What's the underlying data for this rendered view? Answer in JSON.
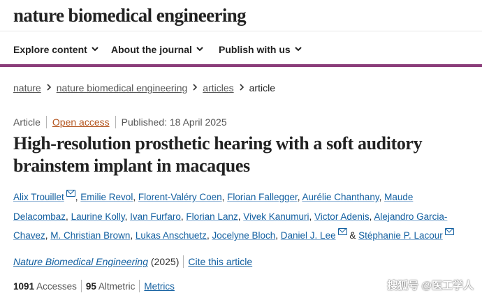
{
  "site": {
    "brand": "nature biomedical engineering"
  },
  "nav": {
    "items": [
      {
        "label": "Explore content"
      },
      {
        "label": "About the journal"
      },
      {
        "label": "Publish with us"
      }
    ]
  },
  "breadcrumb": {
    "items": [
      "nature",
      "nature biomedical engineering",
      "articles"
    ],
    "current": "article"
  },
  "article": {
    "type": "Article",
    "access": "Open access",
    "published": "Published: 18 April 2025",
    "title": "High-resolution prosthetic hearing with a soft auditory brainstem implant in macaques",
    "authors": [
      "Alix Trouillet",
      "Emilie Revol",
      "Florent-Valéry Coen",
      "Florian Fallegger",
      "Aurélie Chanthany",
      "Maude Delacombaz",
      "Laurine Kolly",
      "Ivan Furfaro",
      "Florian Lanz",
      "Vivek Kanumuri",
      "Victor Adenis",
      "Alejandro Garcia-Chavez",
      "M. Christian Brown",
      "Lukas Anschuetz",
      "Jocelyne Bloch",
      "Daniel J. Lee",
      "Stéphanie P. Lacour"
    ],
    "authors_ampersand": "&",
    "journal": "Nature Biomedical Engineering",
    "year": "(2025)",
    "cite": "Cite this article",
    "accesses_count": "1091",
    "accesses_label": "Accesses",
    "altmetric_count": "95",
    "altmetric_label": "Altmetric",
    "metrics_link": "Metrics"
  },
  "watermark": "搜狐号 @医工学人",
  "icons": {
    "chevron": "chevron-down-icon",
    "email": "mail-icon"
  },
  "colors": {
    "accent": "#8b3d7a",
    "link": "#125fa0",
    "open_access": "#b3541e"
  }
}
